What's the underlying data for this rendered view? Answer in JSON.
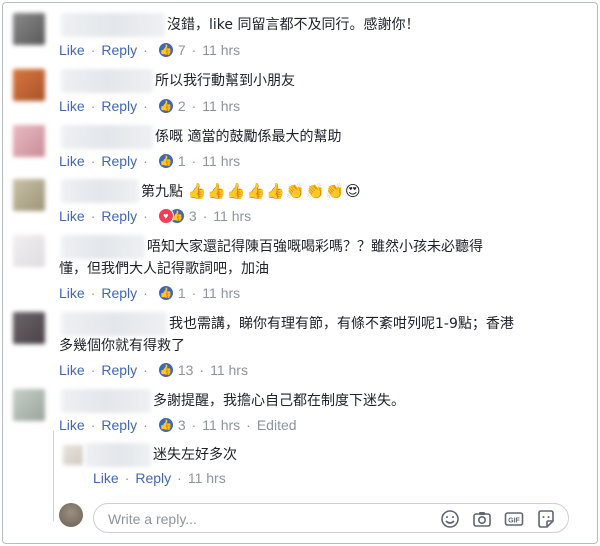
{
  "actions": {
    "like": "Like",
    "reply": "Reply"
  },
  "comments": [
    {
      "text": "沒錯，like 同留言都不及同行。感謝你！",
      "reactions": "7",
      "time": "11 hrs"
    },
    {
      "text": "所以我行動幫到小朋友",
      "reactions": "2",
      "time": "11 hrs"
    },
    {
      "text": "係嘅 適當的鼓勵係最大的幫助",
      "reactions": "1",
      "time": "11 hrs"
    },
    {
      "text": "第九點",
      "emoji": [
        "👍",
        "👍",
        "👍",
        "👍",
        "👍",
        "👏",
        "👏",
        "👏",
        "😍"
      ],
      "reactions": "3",
      "time": "11 hrs"
    },
    {
      "text_line1": "唔知大家還記得陳百強嘅喝彩嗎？？雖然小孩未必聽得",
      "text_line2": "懂，但我們大人記得歌詞吧，加油",
      "reactions": "1",
      "time": "11 hrs"
    },
    {
      "text_line1": "我也需講，睇你有理有節，有條不紊咁列呢1-9點；香港",
      "text_line2": "多幾個你就有得救了",
      "reactions": "13",
      "time": "11 hrs"
    },
    {
      "text": "多謝提醒，我擔心自己都在制度下迷失。",
      "reactions": "3",
      "time": "11 hrs",
      "edited": "Edited"
    }
  ],
  "reply": {
    "text": "迷失左好多次",
    "time": "11 hrs"
  },
  "composer": {
    "placeholder": "Write a reply...",
    "icons": [
      "smiley-icon",
      "camera-icon",
      "gif-icon",
      "sticker-icon"
    ]
  },
  "colors": {
    "link": "#4267b2",
    "meta": "#8d949e",
    "text": "#1d2129",
    "love": "#f33e58"
  }
}
